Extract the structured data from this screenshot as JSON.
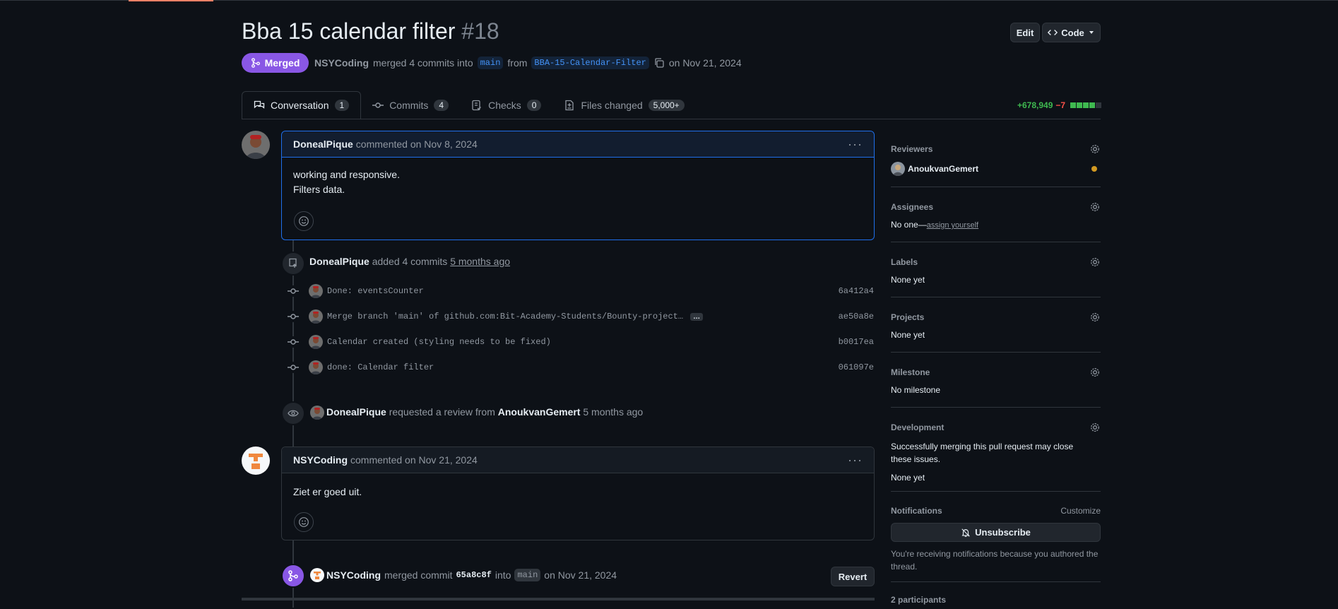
{
  "pr": {
    "title": "Bba 15 calendar filter",
    "number": "#18",
    "status": "Merged",
    "author": "NSYCoding",
    "merged_text": "merged 4 commits into",
    "base_branch": "main",
    "from_text": "from",
    "head_branch": "BBA-15-Calendar-Filter",
    "date_text": "on Nov 21, 2024"
  },
  "header_buttons": {
    "edit": "Edit",
    "code": "Code"
  },
  "tabs": [
    {
      "label": "Conversation",
      "count": "1"
    },
    {
      "label": "Commits",
      "count": "4"
    },
    {
      "label": "Checks",
      "count": "0"
    },
    {
      "label": "Files changed",
      "count": "5,000+"
    }
  ],
  "diffstat": {
    "additions": "+678,949",
    "deletions": "−7"
  },
  "comment1": {
    "author": "DonealPique",
    "meta": "commented on Nov 8, 2024",
    "lines": [
      "working and responsive.",
      "Filters data."
    ]
  },
  "commits_event": {
    "author": "DonealPique",
    "text": "added 4 commits",
    "time": "5 months ago"
  },
  "commits": [
    {
      "message": "Done: eventsCounter",
      "sha": "6a412a4",
      "more": ""
    },
    {
      "message": "Merge branch 'main' of github.com:Bit-Academy-Students/Bounty-project…",
      "sha": "ae50a8e",
      "more": "…"
    },
    {
      "message": "Calendar created (styling needs to be fixed)",
      "sha": "b0017ea",
      "more": ""
    },
    {
      "message": "done: Calendar filter",
      "sha": "061097e",
      "more": ""
    }
  ],
  "review_event": {
    "author": "DonealPique",
    "text": "requested a review from",
    "reviewer": "AnoukvanGemert",
    "time": "5 months ago"
  },
  "comment2": {
    "author": "NSYCoding",
    "meta": "commented on Nov 21, 2024",
    "body": "Ziet er goed uit."
  },
  "merge_event": {
    "author": "NSYCoding",
    "text": "merged commit",
    "sha": "65a8c8f",
    "into": "into",
    "branch": "main",
    "date": "on Nov 21, 2024",
    "revert": "Revert"
  },
  "sidebar": {
    "reviewers": {
      "title": "Reviewers",
      "name": "AnoukvanGemert"
    },
    "assignees": {
      "title": "Assignees",
      "value": "No one—",
      "link": "assign yourself"
    },
    "labels": {
      "title": "Labels",
      "value": "None yet"
    },
    "projects": {
      "title": "Projects",
      "value": "None yet"
    },
    "milestone": {
      "title": "Milestone",
      "value": "No milestone"
    },
    "development": {
      "title": "Development",
      "desc": "Successfully merging this pull request may close these issues.",
      "value": "None yet"
    },
    "notifications": {
      "title": "Notifications",
      "customize": "Customize",
      "button": "Unsubscribe",
      "note": "You're receiving notifications because you authored the thread."
    },
    "participants": "2 participants"
  },
  "colors": {
    "merged": "#8957e5",
    "accent": "#1f6feb",
    "add": "#3fb950",
    "del": "#f85149",
    "pending": "#d29922"
  }
}
